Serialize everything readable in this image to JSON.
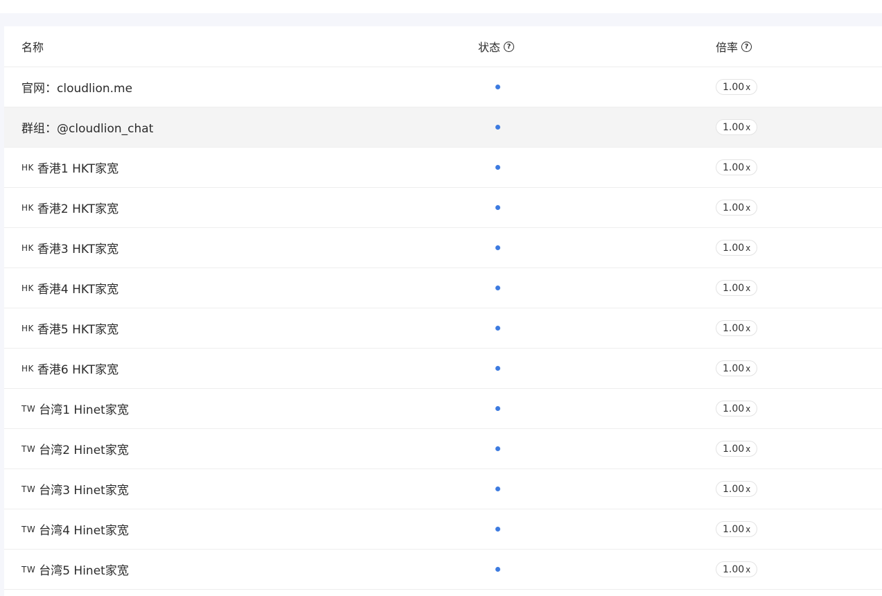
{
  "table": {
    "headers": {
      "name": "名称",
      "status": "状态",
      "rate": "倍率",
      "help_glyph": "?"
    },
    "rate_suffix": "x",
    "status_color": "#3d7be0",
    "rows": [
      {
        "flag": "",
        "name": "官网：cloudlion.me",
        "rate": "1.00",
        "status": "online"
      },
      {
        "flag": "",
        "name": "群组：@cloudlion_chat",
        "rate": "1.00",
        "status": "online"
      },
      {
        "flag": "HK",
        "name": "香港1 HKT家宽",
        "rate": "1.00",
        "status": "online"
      },
      {
        "flag": "HK",
        "name": "香港2 HKT家宽",
        "rate": "1.00",
        "status": "online"
      },
      {
        "flag": "HK",
        "name": "香港3 HKT家宽",
        "rate": "1.00",
        "status": "online"
      },
      {
        "flag": "HK",
        "name": "香港4 HKT家宽",
        "rate": "1.00",
        "status": "online"
      },
      {
        "flag": "HK",
        "name": "香港5 HKT家宽",
        "rate": "1.00",
        "status": "online"
      },
      {
        "flag": "HK",
        "name": "香港6 HKT家宽",
        "rate": "1.00",
        "status": "online"
      },
      {
        "flag": "TW",
        "name": "台湾1 Hinet家宽",
        "rate": "1.00",
        "status": "online"
      },
      {
        "flag": "TW",
        "name": "台湾2 Hinet家宽",
        "rate": "1.00",
        "status": "online"
      },
      {
        "flag": "TW",
        "name": "台湾3 Hinet家宽",
        "rate": "1.00",
        "status": "online"
      },
      {
        "flag": "TW",
        "name": "台湾4 Hinet家宽",
        "rate": "1.00",
        "status": "online"
      },
      {
        "flag": "TW",
        "name": "台湾5 Hinet家宽",
        "rate": "1.00",
        "status": "online"
      }
    ]
  }
}
